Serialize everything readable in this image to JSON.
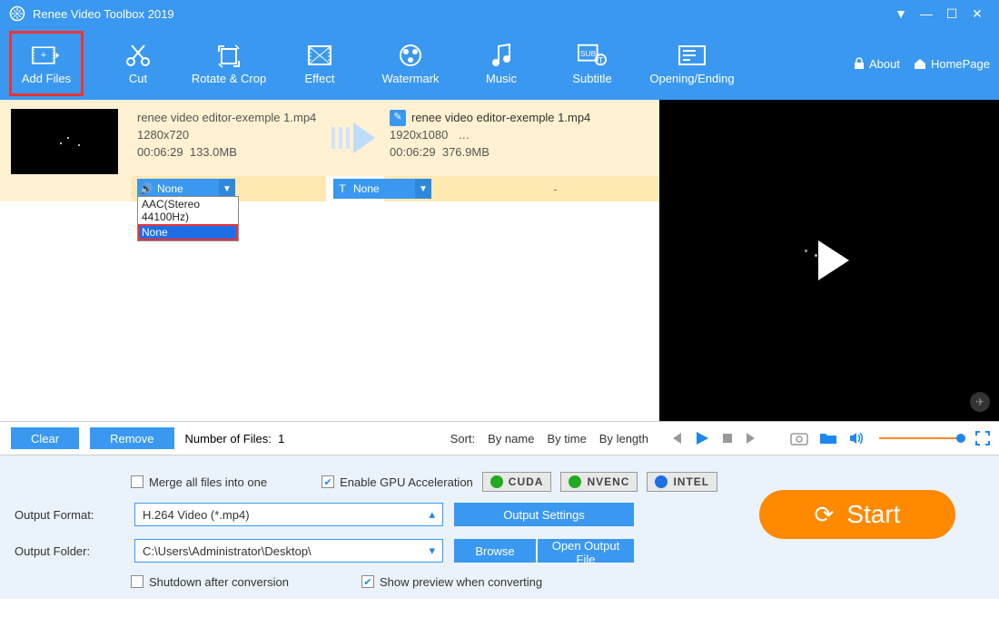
{
  "app": {
    "title": "Renee Video Toolbox 2019"
  },
  "toolbar": {
    "add_files": "Add Files",
    "cut": "Cut",
    "rotate_crop": "Rotate & Crop",
    "effect": "Effect",
    "watermark": "Watermark",
    "music": "Music",
    "subtitle": "Subtitle",
    "opening_ending": "Opening/Ending",
    "about": "About",
    "homepage": "HomePage"
  },
  "file": {
    "src_name": "renee video editor-exemple 1.mp4",
    "src_res": "1280x720",
    "src_time": "00:06:29",
    "src_size": "133.0MB",
    "dst_name": "renee video editor-exemple 1.mp4",
    "dst_res": "1920x1080",
    "dst_more": "…",
    "dst_time": "00:06:29",
    "dst_size": "376.9MB",
    "audio_value": "None",
    "sub_value": "None",
    "dash": "-",
    "audio_options": {
      "opt_aac": "AAC(Stereo 44100Hz)",
      "opt_none": "None"
    }
  },
  "listfooter": {
    "clear": "Clear",
    "remove": "Remove",
    "count_label": "Number of Files:",
    "count_value": "1",
    "sort_label": "Sort:",
    "by_name": "By name",
    "by_time": "By time",
    "by_length": "By length"
  },
  "bottom": {
    "merge": "Merge all files into one",
    "gpu": "Enable GPU Acceleration",
    "cuda": "CUDA",
    "nvenc": "NVENC",
    "intel": "INTEL",
    "out_format_label": "Output Format:",
    "out_format_value": "H.264 Video (*.mp4)",
    "output_settings": "Output Settings",
    "out_folder_label": "Output Folder:",
    "out_folder_value": "C:\\Users\\Administrator\\Desktop\\",
    "browse": "Browse",
    "open_output": "Open Output File",
    "shutdown": "Shutdown after conversion",
    "show_preview": "Show preview when converting",
    "start": "Start"
  }
}
